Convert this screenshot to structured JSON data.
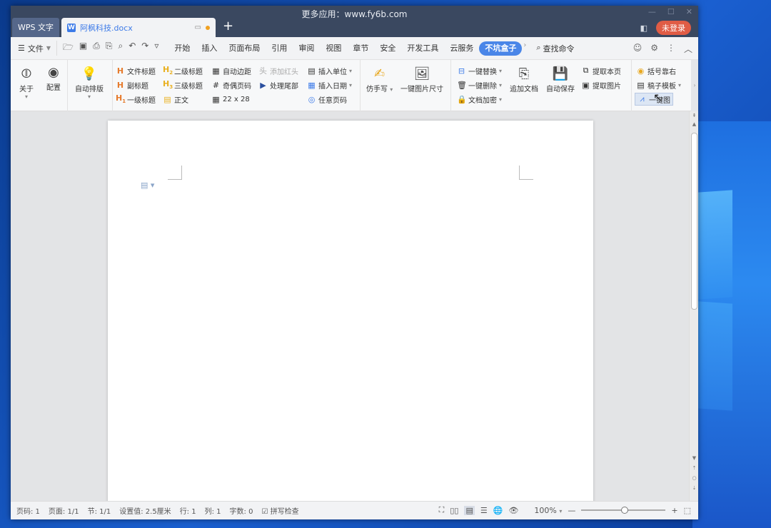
{
  "window_title": "更多应用：www.fy6b.com",
  "tabs": {
    "app": "WPS 文字",
    "doc": "阿枫科技.docx",
    "new": "+"
  },
  "titlebar_right": {
    "login": "未登录"
  },
  "menu": {
    "file": "文件",
    "tabs": [
      "开始",
      "插入",
      "页面布局",
      "引用",
      "审阅",
      "视图",
      "章节",
      "安全",
      "开发工具",
      "云服务",
      "不坑盒子"
    ],
    "active_tab": "不坑盒子",
    "search": "查找命令"
  },
  "ribbon": {
    "about": "关于",
    "config": "配置",
    "auto_layout": "自动排版",
    "doc_title": "文件标题",
    "subtitle": "副标题",
    "h1": "一级标题",
    "h2": "二级标题",
    "h3": "三级标题",
    "body_text": "正文",
    "auto_margin": "自动边距",
    "odd_even_page": "奇偶页码",
    "grid_size": "22 x 28",
    "add_header": "添加红头",
    "process_tail": "处理尾部",
    "insert_unit": "插入单位",
    "insert_date": "插入日期",
    "any_page": "任意页码",
    "imitate": "仿手写",
    "img_size": "一键图片尺寸",
    "replace": "一键替换",
    "delete": "一键删除",
    "encrypt": "文档加密",
    "append_doc": "追加文档",
    "auto_save": "自动保存",
    "extract_page": "提取本页",
    "extract_img": "提取图片",
    "bracket_right": "括号靠右",
    "template": "稿子模板",
    "one_click_chart": "一键图"
  },
  "status": {
    "page_no": "页码: 1",
    "pages": "页面: 1/1",
    "section": "节: 1/1",
    "setting": "设置值: 2.5厘米",
    "row": "行: 1",
    "col": "列: 1",
    "words": "字数: 0",
    "spell": "拼写检查",
    "zoom": "100%"
  }
}
